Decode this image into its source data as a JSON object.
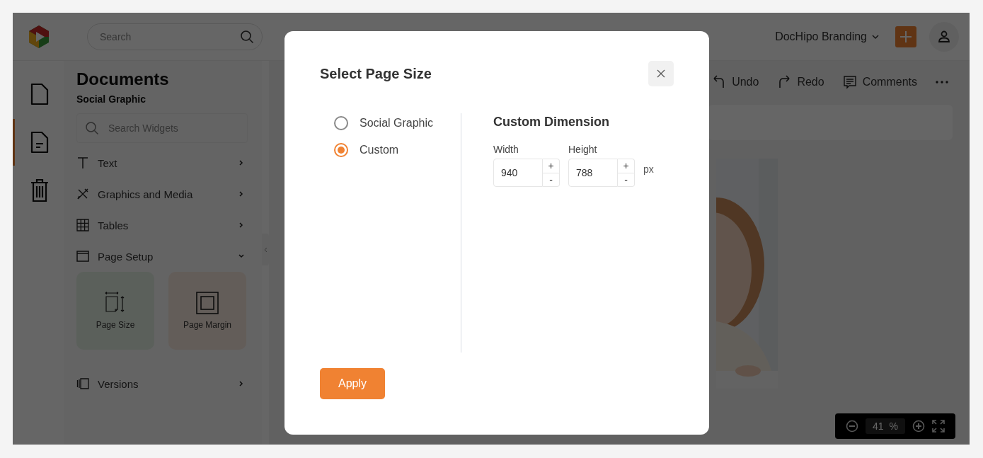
{
  "topbar": {
    "search": {
      "placeholder": "Search"
    },
    "brand": "DocHipo Branding"
  },
  "rail": [
    {
      "kind": "document",
      "selected": false
    },
    {
      "kind": "document-text",
      "selected": true
    },
    {
      "kind": "trash",
      "selected": false
    }
  ],
  "panel": {
    "title": "Documents",
    "subtitle": "Social Graphic",
    "search": {
      "placeholder": "Search Widgets"
    },
    "items": [
      {
        "kind": "text",
        "label": "Text",
        "expanded": false
      },
      {
        "kind": "graphics",
        "label": "Graphics and Media",
        "expanded": false
      },
      {
        "kind": "tables",
        "label": "Tables",
        "expanded": false
      },
      {
        "kind": "page-setup",
        "label": "Page Setup",
        "expanded": true,
        "tiles": [
          {
            "kind": "size",
            "label": "Page Size"
          },
          {
            "kind": "margin",
            "label": "Page Margin"
          }
        ]
      },
      {
        "kind": "versions",
        "label": "Versions",
        "expanded": false
      }
    ]
  },
  "toolbar": [
    {
      "kind": "undo",
      "label": "Undo"
    },
    {
      "kind": "redo",
      "label": "Redo"
    },
    {
      "kind": "comments",
      "label": "Comments"
    },
    {
      "kind": "more"
    }
  ],
  "zoom": {
    "value": "41",
    "unit": "%"
  },
  "modal": {
    "title": "Select Page Size",
    "options": [
      {
        "label": "Social Graphic",
        "selected": false
      },
      {
        "label": "Custom",
        "selected": true
      }
    ],
    "custom": {
      "heading": "Custom Dimension",
      "fields": [
        {
          "label": "Width",
          "value": "940",
          "increment": "+",
          "decrement": "-"
        },
        {
          "label": "Height",
          "value": "788",
          "increment": "+",
          "decrement": "-"
        }
      ],
      "unit": "px"
    },
    "apply": "Apply"
  }
}
